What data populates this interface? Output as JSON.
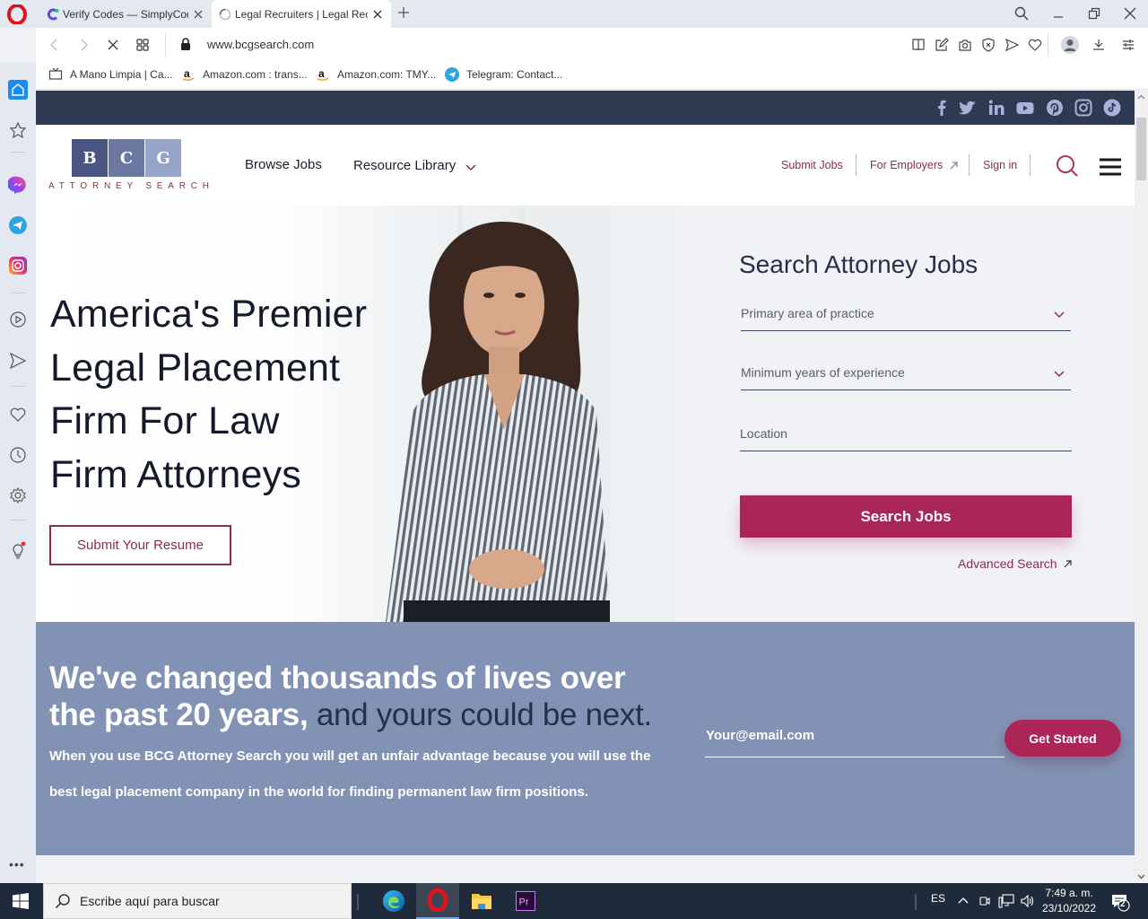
{
  "browser": {
    "tabs": [
      {
        "label": "Verify Codes — SimplyCodes",
        "icon": "simplycodes-icon",
        "active": false
      },
      {
        "label": "Legal Recruiters | Legal Recruiters",
        "icon": "loading-spinner-icon",
        "active": true
      }
    ],
    "url": "www.bcgsearch.com",
    "bookmarks": [
      {
        "label": "A Mano Limpia | Ca...",
        "icon": "tv-icon"
      },
      {
        "label": "Amazon.com : trans...",
        "icon": "amazon-icon"
      },
      {
        "label": "Amazon.com: TMY...",
        "icon": "amazon-icon"
      },
      {
        "label": "Telegram: Contact...",
        "icon": "telegram-icon"
      }
    ],
    "toolbar_icons": [
      "reader-icon",
      "edit-icon",
      "snapshot-icon",
      "adblock-icon",
      "send-icon",
      "heart-icon",
      "profile-icon",
      "download-icon",
      "easy-setup-icon"
    ],
    "sidebar_icons": [
      "home-icon",
      "star-icon",
      "messenger-icon",
      "telegram-icon",
      "instagram-icon",
      "player-icon",
      "flow-icon",
      "heart-icon",
      "history-icon",
      "settings-icon",
      "tips-icon"
    ],
    "more_label": "•••"
  },
  "site": {
    "social_icons": [
      "facebook-icon",
      "twitter-icon",
      "linkedin-icon",
      "youtube-icon",
      "pinterest-icon",
      "instagram-icon",
      "tiktok-icon"
    ],
    "logo": {
      "letters": [
        "B",
        "C",
        "G"
      ],
      "subtitle": "ATTORNEY SEARCH"
    },
    "nav": {
      "browse_jobs": "Browse Jobs",
      "resource_library": "Resource Library",
      "submit_jobs": "Submit Jobs",
      "for_employers": "For Employers",
      "sign_in": "Sign in"
    },
    "hero": {
      "title_lines": [
        "America's Premier",
        "Legal Placement",
        "Firm For Law",
        "Firm Attorneys"
      ],
      "resume_button": "Submit Your Resume"
    },
    "search": {
      "title": "Search Attorney Jobs",
      "practice_area": "Primary area of practice",
      "experience": "Minimum years of experience",
      "location": "Location",
      "button": "Search Jobs",
      "advanced": "Advanced Search"
    },
    "band": {
      "title_light": "We've changed thousands of lives over the past 20 years,",
      "title_dark": "and yours could be next.",
      "body": "When you use BCG Attorney Search you will get an unfair advantage because you will use the best legal placement company in the world for finding permanent law firm positions.",
      "email_placeholder": "Your@email.com",
      "cta": "Get Started"
    },
    "colors": {
      "brand": "#a82555",
      "navy": "#2e3a52",
      "band": "#8292b4"
    }
  },
  "taskbar": {
    "search_placeholder": "Escribe aquí para buscar",
    "apps": [
      "edge-icon",
      "opera-icon",
      "file-explorer-icon",
      "premiere-icon"
    ],
    "language": "ES",
    "time": "7:49 a. m.",
    "date": "23/10/2022",
    "notifications": "2"
  }
}
